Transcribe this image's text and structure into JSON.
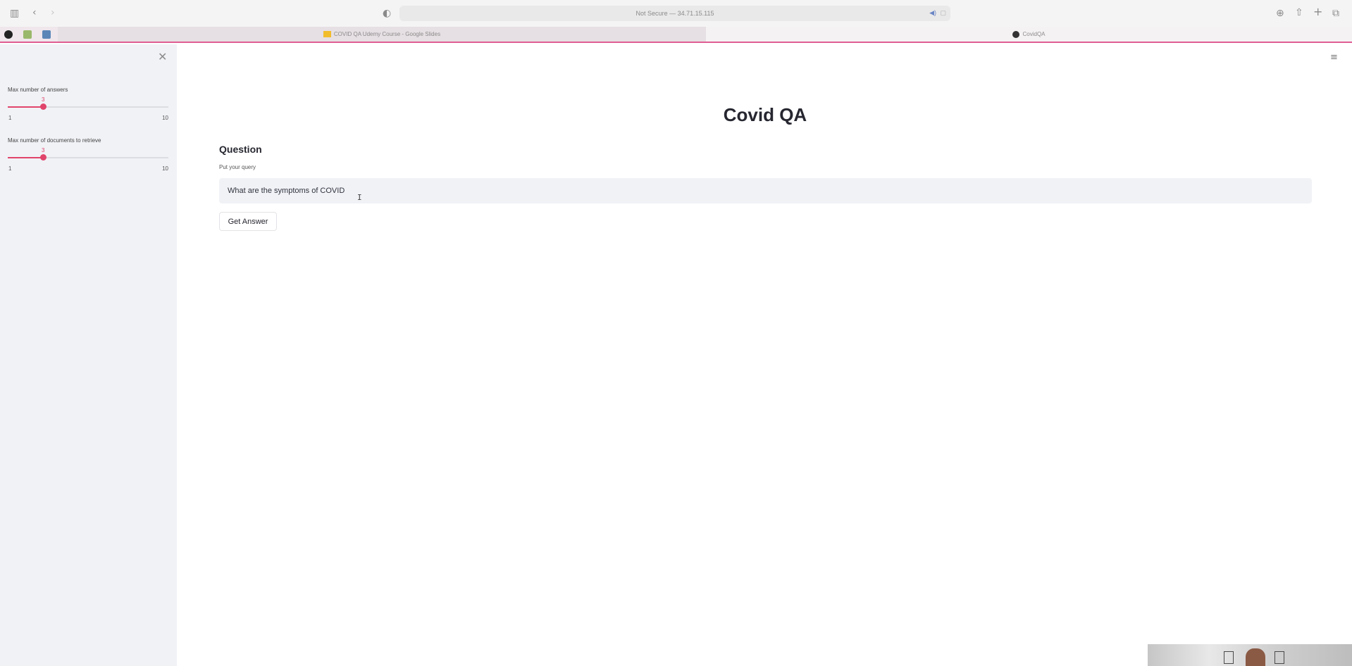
{
  "browser": {
    "address_text": "Not Secure — 34.71.15.115",
    "tabs": [
      {
        "label": "COVID QA Udemy Course - Google Slides",
        "active": false
      },
      {
        "label": "CovidQA",
        "active": true
      }
    ]
  },
  "sidebar": {
    "sliders": [
      {
        "label": "Max number of answers",
        "value": "3",
        "min": "1",
        "max": "10"
      },
      {
        "label": "Max number of documents to retrieve",
        "value": "3",
        "min": "1",
        "max": "10"
      }
    ]
  },
  "main": {
    "title": "Covid QA",
    "question_heading": "Question",
    "input_label": "Put your query",
    "input_value": "What are the symptoms of COVID",
    "button_label": "Get Answer"
  },
  "colors": {
    "accent": "#e0446b",
    "sidebar_bg": "#f1f2f6",
    "input_bg": "#f0f2f6"
  }
}
